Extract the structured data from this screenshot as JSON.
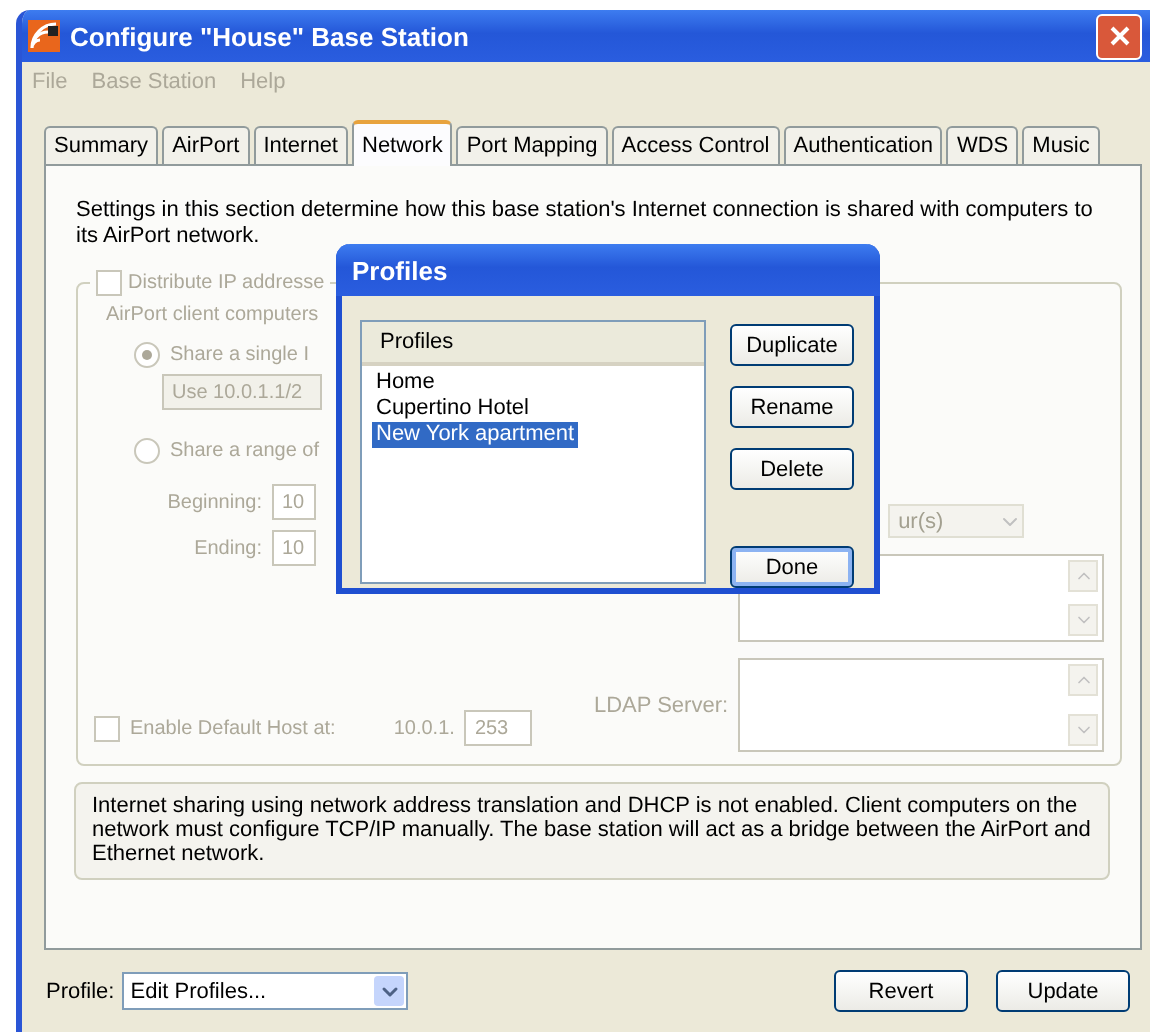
{
  "window": {
    "title": "Configure \"House\" Base Station"
  },
  "menu": [
    {
      "label": "File",
      "disabled": true
    },
    {
      "label": "Base Station",
      "disabled": true
    },
    {
      "label": "Help",
      "disabled": true
    }
  ],
  "tabs": [
    {
      "label": "Summary",
      "selected": false
    },
    {
      "label": "AirPort",
      "selected": false
    },
    {
      "label": "Internet",
      "selected": false
    },
    {
      "label": "Network",
      "selected": true
    },
    {
      "label": "Port Mapping",
      "selected": false
    },
    {
      "label": "Access Control",
      "selected": false
    },
    {
      "label": "Authentication",
      "selected": false
    },
    {
      "label": "WDS",
      "selected": false
    },
    {
      "label": "Music",
      "selected": false
    }
  ],
  "network": {
    "description": "Settings in this section determine how this base station's Internet connection is shared with computers to its AirPort network.",
    "disabled": true,
    "distribute": {
      "label": "Distribute IP addresse",
      "checked": false
    },
    "client_label": "AirPort client computers",
    "options": [
      {
        "label": "Share a single I",
        "selected": true
      },
      {
        "label": "Share a range of",
        "selected": false
      }
    ],
    "single_ip_select": "Use 10.0.1.1/2",
    "beginning": {
      "label": "Beginning:",
      "value": "10"
    },
    "ending": {
      "label": "Ending:",
      "value": "10"
    },
    "lease_select": "ur(s)",
    "ldap_label": "LDAP Server:",
    "default_host": {
      "label": "Enable Default Host at:",
      "checked": false,
      "prefix": "10.0.1.",
      "value": "253"
    },
    "info": "Internet sharing using network address translation and DHCP is not enabled. Client computers on the network must configure TCP/IP manually. The base station will act as a bridge between the AirPort and Ethernet network."
  },
  "profile": {
    "label": "Profile:",
    "value": "Edit Profiles..."
  },
  "buttons": [
    "Revert",
    "Update"
  ],
  "dialog": {
    "title": "Profiles",
    "column": "Profiles",
    "items": [
      {
        "label": "Home",
        "selected": false
      },
      {
        "label": "Cupertino Hotel",
        "selected": false
      },
      {
        "label": "New York apartment",
        "selected": true
      }
    ],
    "buttons": [
      {
        "label": "Duplicate",
        "default": false
      },
      {
        "label": "Rename",
        "default": false
      },
      {
        "label": "Delete",
        "default": false
      },
      {
        "label": "Done",
        "default": true
      }
    ]
  }
}
